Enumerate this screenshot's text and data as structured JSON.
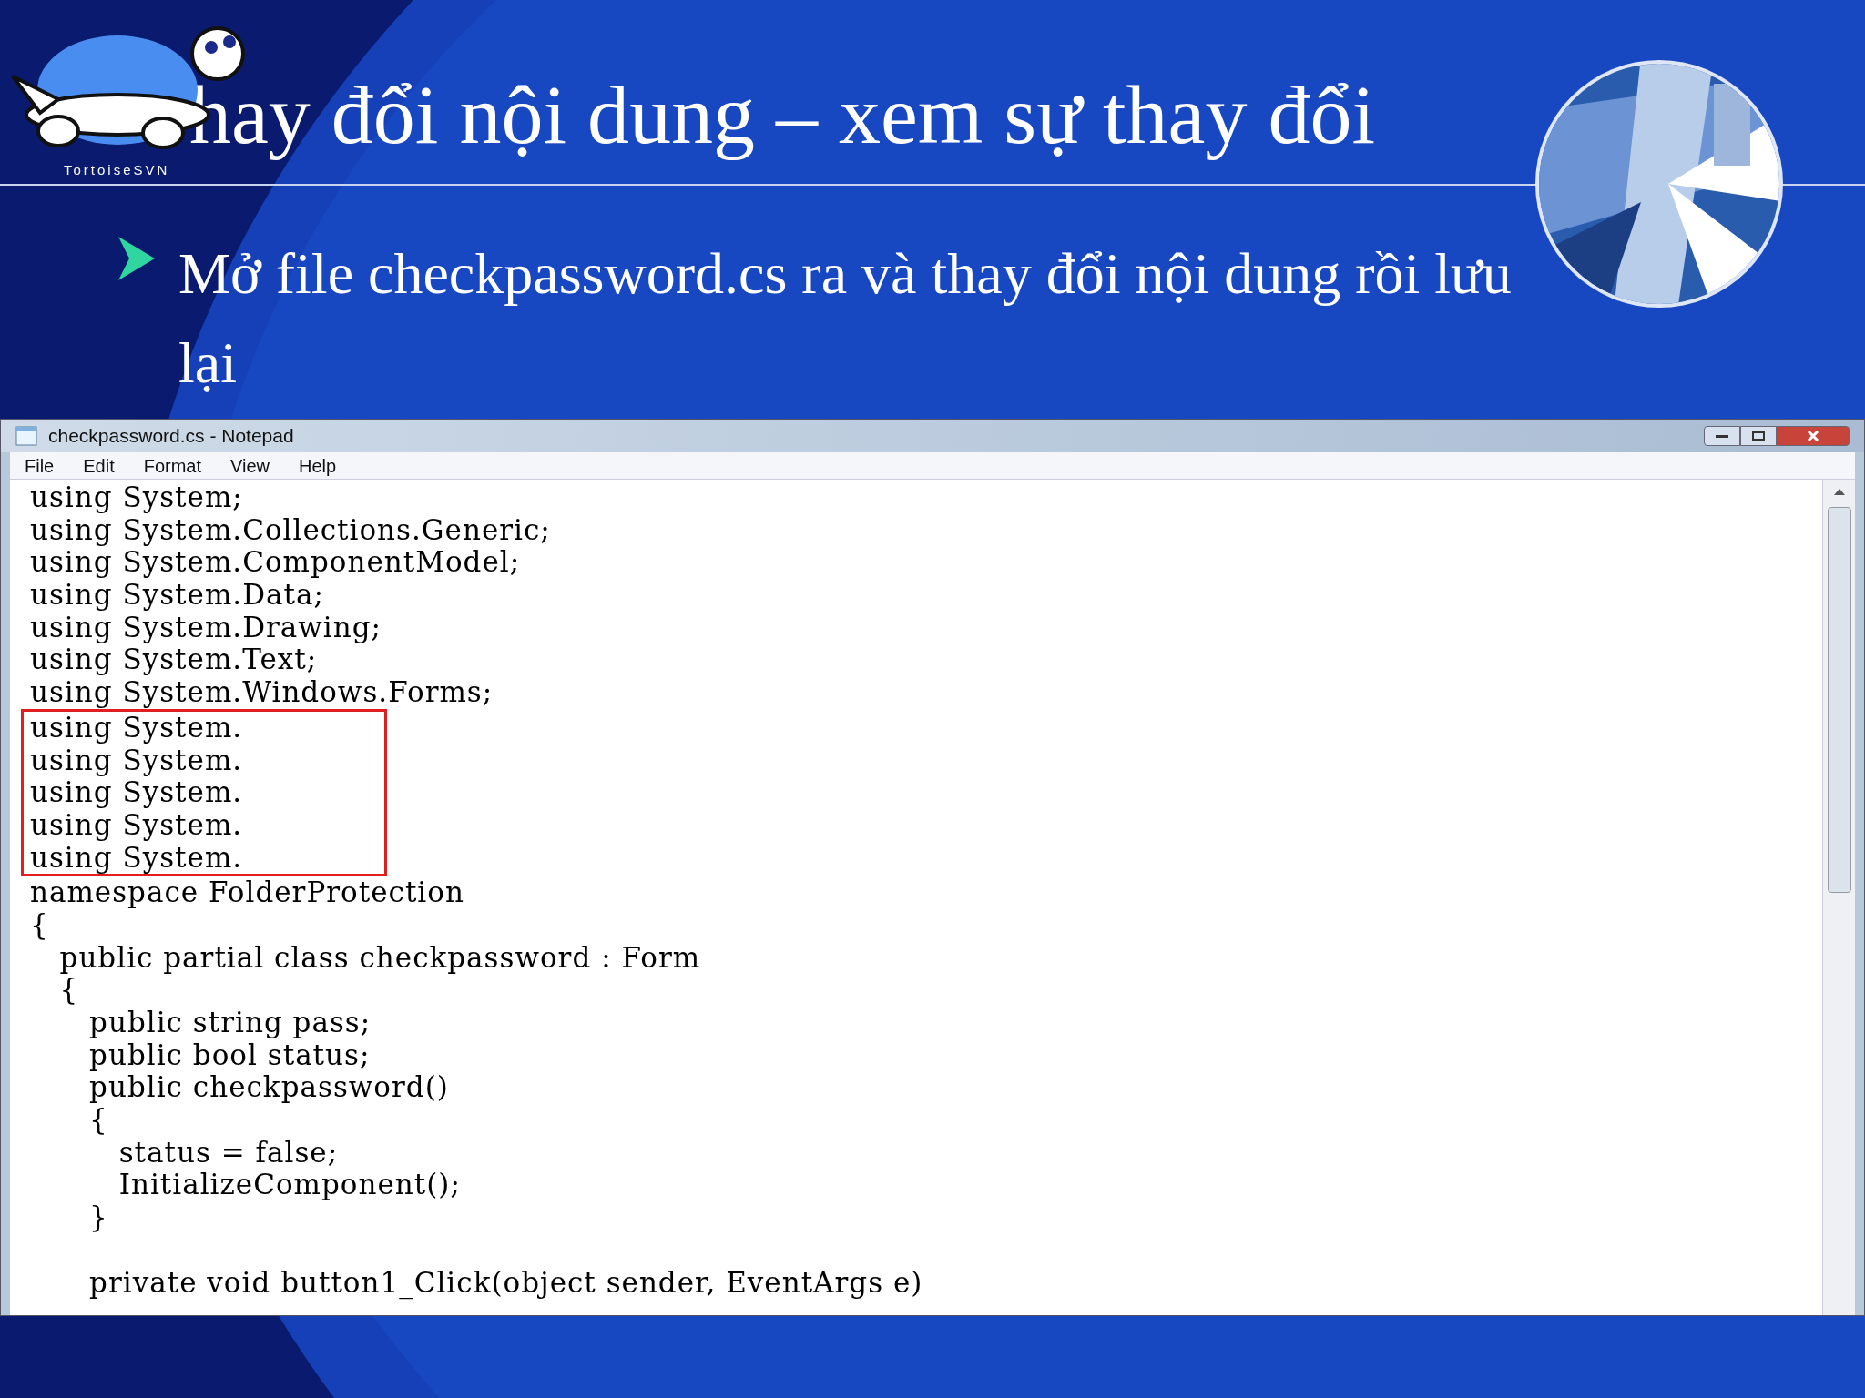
{
  "slide": {
    "title": "hay đổi nội dung – xem sự thay đổi",
    "logo_caption": "TortoiseSVN",
    "bullet": "Mở file checkpassword.cs ra và thay đổi nội dung rồi lưu lại"
  },
  "notepad": {
    "title": "checkpassword.cs - Notepad",
    "menu": [
      "File",
      "Edit",
      "Format",
      "View",
      "Help"
    ],
    "blocks": [
      {
        "kind": "plain",
        "lines": [
          "using System;",
          "using System.Collections.Generic;",
          "using System.ComponentModel;",
          "using System.Data;",
          "using System.Drawing;",
          "using System.Text;",
          "using System.Windows.Forms;"
        ]
      },
      {
        "kind": "highlighted",
        "lines": [
          "using System.",
          "using System.",
          "using System.",
          "using System.",
          "using System."
        ]
      },
      {
        "kind": "plain",
        "lines": [
          "namespace FolderProtection",
          "{",
          "   public partial class checkpassword : Form",
          "   {",
          "      public string pass;",
          "      public bool status;",
          "      public checkpassword()",
          "      {",
          "         status = false;",
          "         InitializeComponent();",
          "      }"
        ]
      },
      {
        "kind": "blank"
      },
      {
        "kind": "plain",
        "lines": [
          "      private void button1_Click(object sender, EventArgs e)"
        ]
      }
    ]
  }
}
